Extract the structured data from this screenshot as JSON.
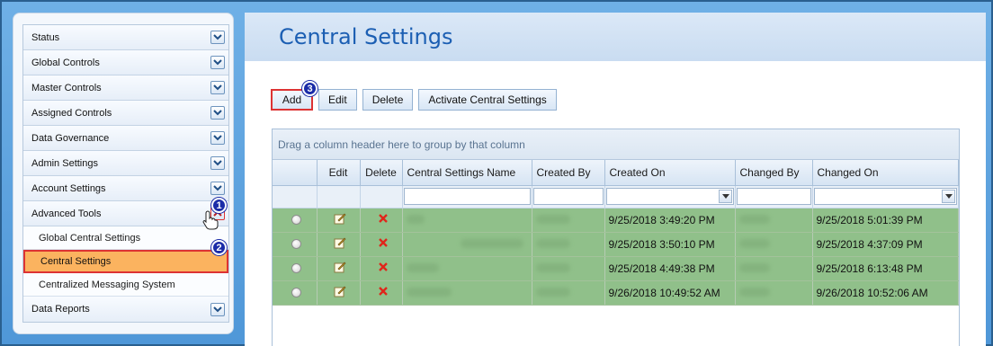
{
  "sidebar": {
    "items": [
      {
        "label": "Status"
      },
      {
        "label": "Global Controls"
      },
      {
        "label": "Master Controls"
      },
      {
        "label": "Assigned Controls"
      },
      {
        "label": "Data Governance"
      },
      {
        "label": "Admin Settings"
      },
      {
        "label": "Account Settings"
      },
      {
        "label": "Advanced Tools"
      }
    ],
    "sub_items": [
      {
        "label": "Global Central Settings"
      },
      {
        "label": "Central Settings"
      },
      {
        "label": "Centralized Messaging System"
      }
    ],
    "bottom_item": {
      "label": "Data Reports"
    }
  },
  "badges": [
    "1",
    "2",
    "3"
  ],
  "page": {
    "title": "Central Settings"
  },
  "toolbar": {
    "add_label": "Add",
    "edit_label": "Edit",
    "delete_label": "Delete",
    "activate_label": "Activate Central Settings"
  },
  "grid": {
    "group_hint": "Drag a column header here to group by that column",
    "columns": [
      "Edit",
      "Delete",
      "Central Settings Name",
      "Created By",
      "Created On",
      "Changed By",
      "Changed On"
    ],
    "rows": [
      {
        "created_on": "9/25/2018 3:49:20 PM",
        "changed_on": "9/25/2018 5:01:39 PM"
      },
      {
        "created_on": "9/25/2018 3:50:10 PM",
        "changed_on": "9/25/2018 4:37:09 PM"
      },
      {
        "created_on": "9/25/2018 4:49:38 PM",
        "changed_on": "9/25/2018 6:13:48 PM"
      },
      {
        "created_on": "9/26/2018 10:49:52 AM",
        "changed_on": "9/26/2018 10:52:06 AM"
      }
    ]
  },
  "colors": {
    "accent": "#1c5fb3",
    "highlight": "#fbb35f",
    "row_green": "#90c08a",
    "badge": "#1b2ca8",
    "callout_red": "#dd3333"
  }
}
